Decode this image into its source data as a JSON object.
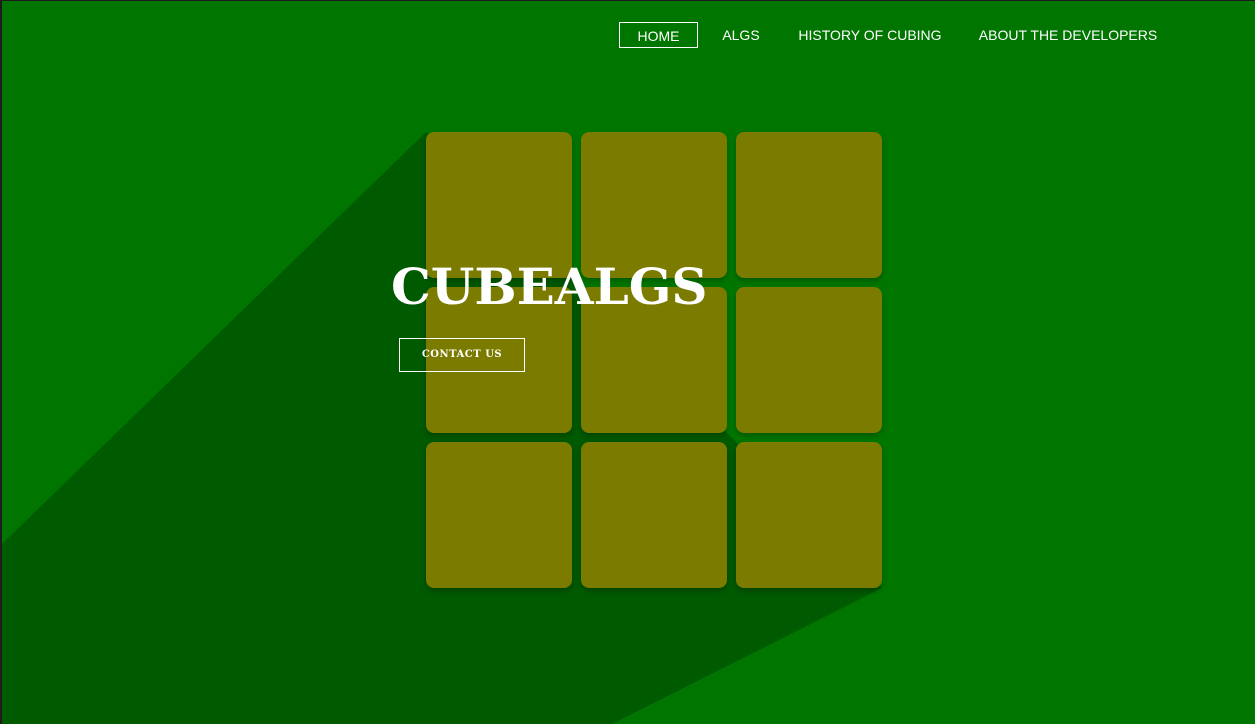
{
  "nav": {
    "items": [
      {
        "label": "HOME",
        "active": true
      },
      {
        "label": "ALGS",
        "active": false
      },
      {
        "label": "HISTORY OF CUBING",
        "active": false
      },
      {
        "label": "ABOUT THE DEVELOPERS",
        "active": false
      }
    ]
  },
  "hero": {
    "title": "CUBEALGS",
    "button_label": "CONTACT US"
  },
  "colors": {
    "background": "#007600",
    "shadow": "#005a00",
    "sticker": "#7b7b00",
    "text": "#ffffff"
  }
}
